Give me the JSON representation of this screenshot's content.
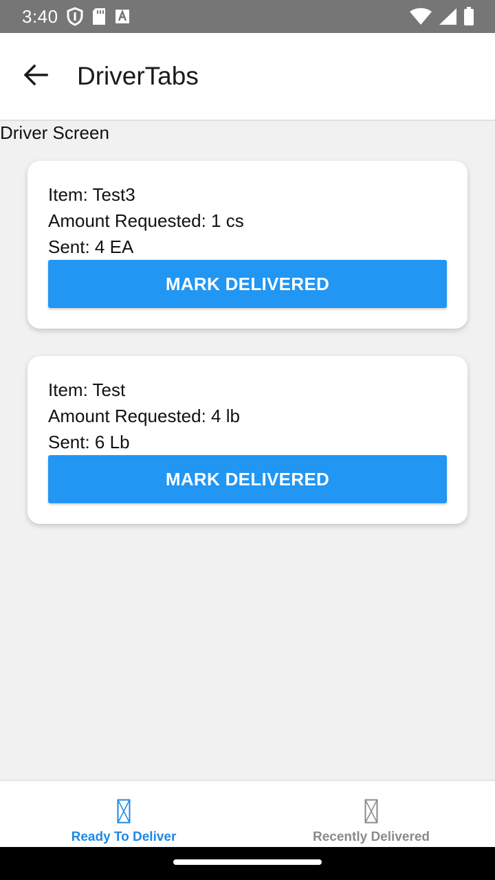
{
  "status_bar": {
    "time": "3:40"
  },
  "app_bar": {
    "title": "DriverTabs"
  },
  "screen_label": "Driver Screen",
  "cards": [
    {
      "item": "Item: Test3",
      "amount": "Amount Requested: 1 cs",
      "sent": "Sent: 4 EA",
      "button": "MARK DELIVERED"
    },
    {
      "item": "Item: Test",
      "amount": "Amount Requested: 4 lb",
      "sent": "Sent: 6 Lb",
      "button": "MARK DELIVERED"
    }
  ],
  "tabs": [
    {
      "label": "Ready To Deliver",
      "active": true,
      "icon": "placeholder-icon"
    },
    {
      "label": "Recently Delivered",
      "active": false,
      "icon": "placeholder-icon"
    }
  ],
  "colors": {
    "accent": "#2196f3",
    "active_tab": "#1e88e5",
    "inactive_tab": "#8a8a8a",
    "status_bar": "#767676"
  }
}
